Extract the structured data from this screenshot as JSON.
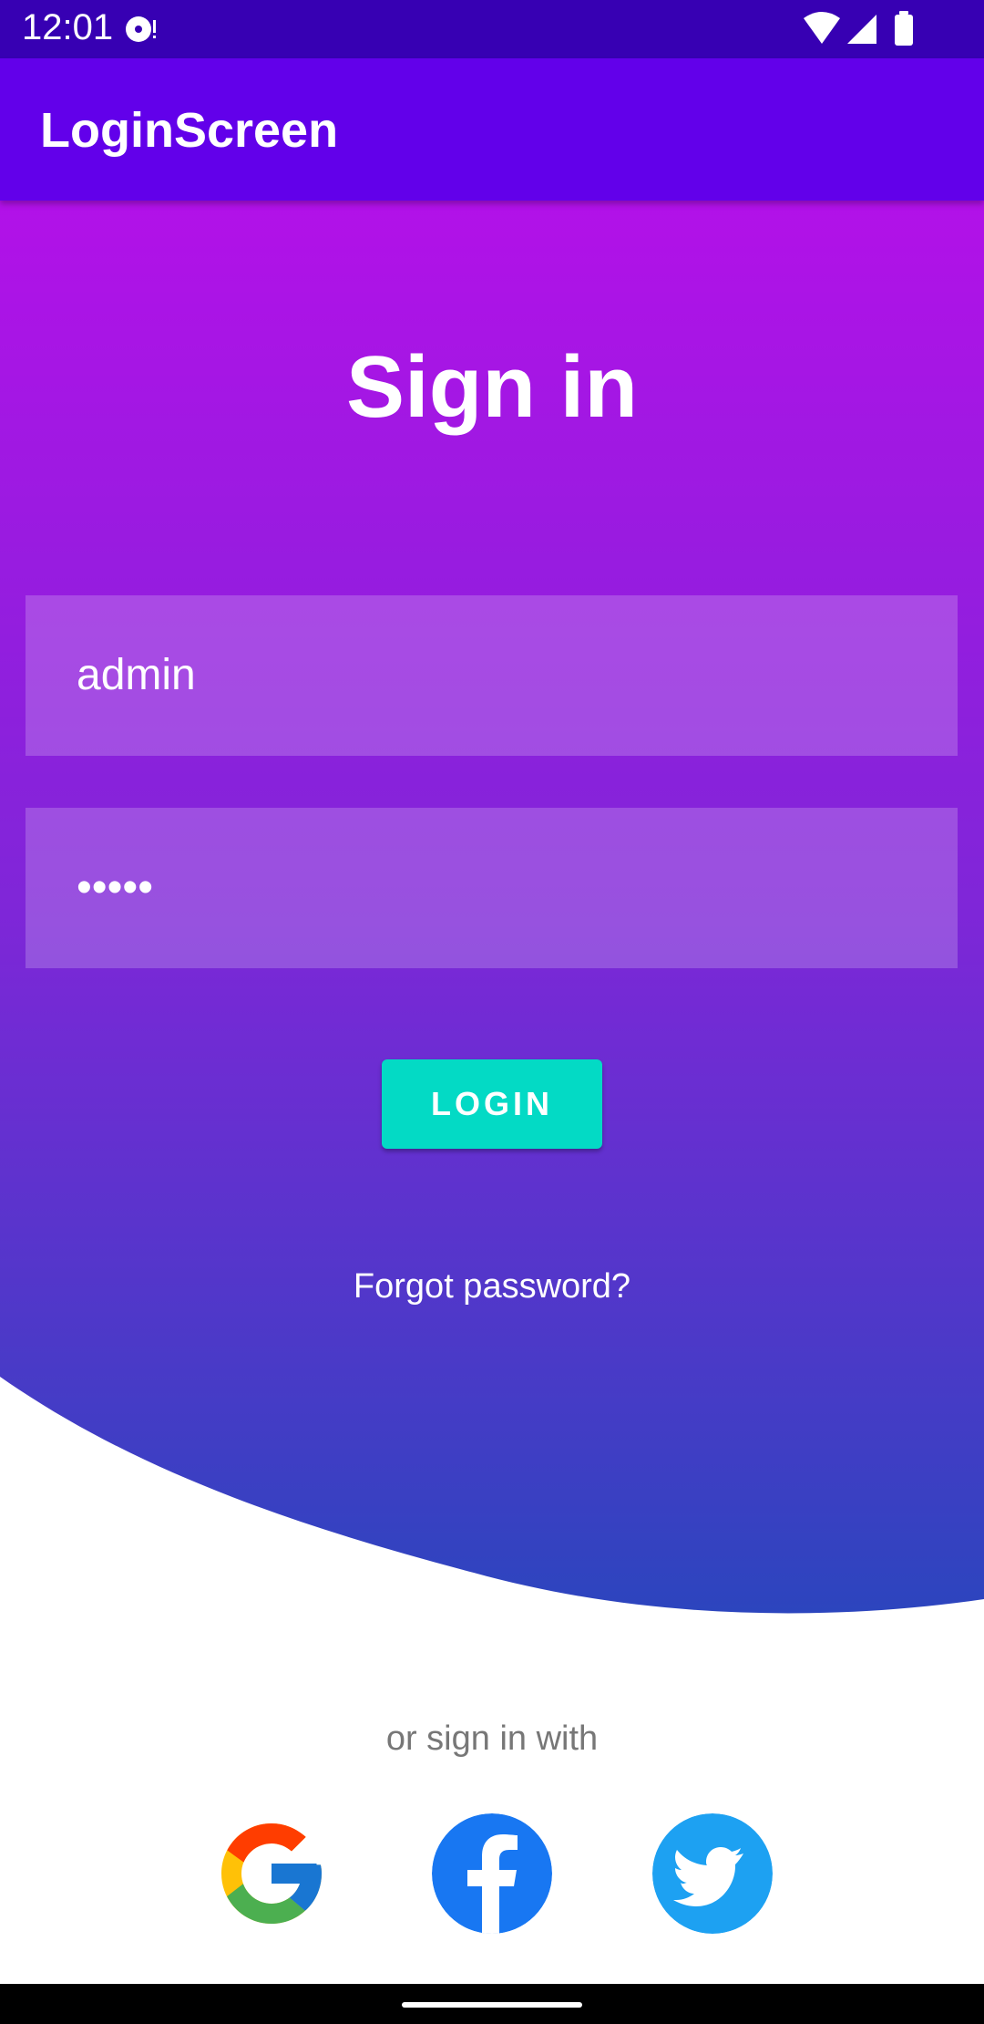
{
  "status_bar": {
    "time": "12:01"
  },
  "app_bar": {
    "title": "LoginScreen"
  },
  "login": {
    "heading": "Sign in",
    "username_value": "admin",
    "password_value": "•••••",
    "login_button": "LOGIN",
    "forgot_password": "Forgot password?"
  },
  "social": {
    "prompt": "or sign in with",
    "providers": [
      "google-icon",
      "facebook-icon",
      "twitter-icon"
    ]
  },
  "colors": {
    "status_bar": "#3700b3",
    "app_bar": "#6200ea",
    "gradient_top": "#b211e8",
    "gradient_bottom": "#2c45be",
    "login_button": "#03dac5",
    "facebook": "#1877f2",
    "twitter": "#1da1f2"
  }
}
